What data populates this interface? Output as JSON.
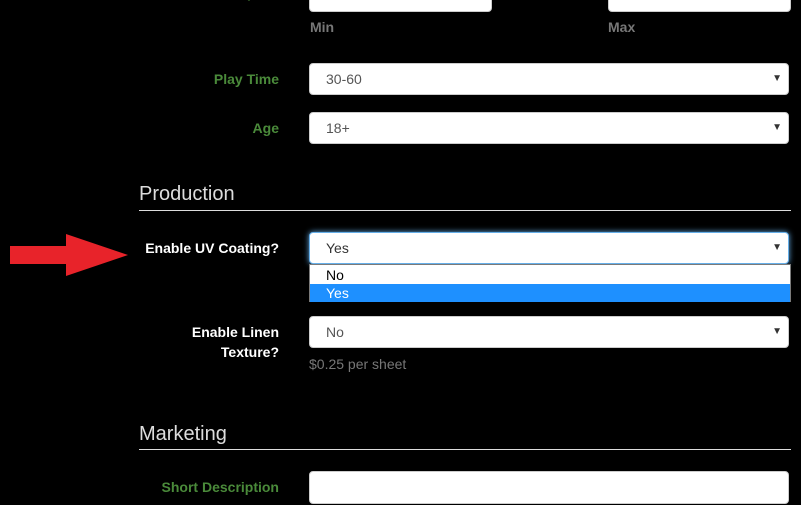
{
  "players": {
    "min_label": "Min",
    "max_label": "Max"
  },
  "play_time": {
    "label": "Play Time",
    "value": "30-60"
  },
  "age": {
    "label": "Age",
    "value": "18+"
  },
  "production": {
    "title": "Production",
    "uv_coating": {
      "label": "Enable UV Coating?",
      "value": "Yes",
      "options": [
        "No",
        "Yes"
      ],
      "highlighted": "Yes"
    },
    "linen_texture": {
      "label_line1": "Enable Linen",
      "label_line2": "Texture?",
      "value": "No",
      "help": "$0.25 per sheet"
    }
  },
  "marketing": {
    "title": "Marketing",
    "short_description": {
      "label": "Short Description",
      "value": ""
    }
  },
  "icons": {
    "caret": "caret-down-icon",
    "pointer": "red-arrow-icon"
  },
  "colors": {
    "accent_green": "#4a8a3a",
    "highlight": "#1e90ff",
    "arrow": "#e8232a"
  }
}
